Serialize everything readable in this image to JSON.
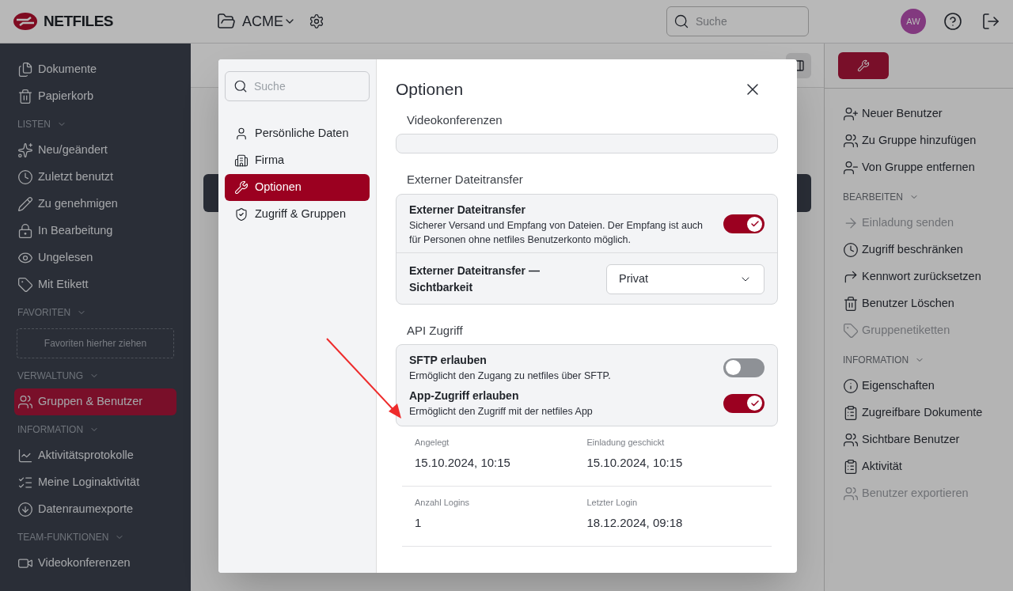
{
  "header": {
    "logo": "NETFILES",
    "workspace": "ACME",
    "search": {
      "placeholder": "Suche"
    },
    "avatar": "AW"
  },
  "sidebar": {
    "sections": [
      {
        "items": [
          {
            "label": "Dokumente",
            "selected": false
          },
          {
            "label": "Papierkorb",
            "selected": false
          }
        ]
      },
      {
        "title": "LISTEN",
        "items": [
          {
            "label": "Neu/geändert",
            "selected": false
          },
          {
            "label": "Zuletzt benutzt",
            "selected": false
          },
          {
            "label": "Zu genehmigen",
            "selected": false
          },
          {
            "label": "In Bearbeitung",
            "selected": false
          },
          {
            "label": "Ungelesen",
            "selected": false
          },
          {
            "label": "Mit Etikett",
            "selected": false
          }
        ]
      },
      {
        "title": "FAVORITEN",
        "dropzone": "Favoriten hierher ziehen"
      },
      {
        "title": "VERWALTUNG",
        "items": [
          {
            "label": "Gruppen & Benutzer",
            "selected": true
          }
        ]
      },
      {
        "title": "INFORMATION",
        "items": [
          {
            "label": "Aktivitätsprotokolle",
            "selected": false
          },
          {
            "label": "Meine Loginaktivität",
            "selected": false
          },
          {
            "label": "Datenraumexporte",
            "selected": false
          }
        ]
      },
      {
        "title": "TEAM-FUNKTIONEN",
        "items": [
          {
            "label": "Videokonferenzen",
            "selected": false
          }
        ]
      }
    ]
  },
  "right_panel": {
    "sections": [
      {
        "items": [
          {
            "label": "Neuer Benutzer",
            "disabled": false
          },
          {
            "label": "Zu Gruppe hinzufügen",
            "disabled": false
          },
          {
            "label": "Von Gruppe entfernen",
            "disabled": false
          }
        ]
      },
      {
        "title": "BEARBEITEN",
        "items": [
          {
            "label": "Einladung senden",
            "disabled": true
          },
          {
            "label": "Zugriff beschränken",
            "disabled": false
          },
          {
            "label": "Kennwort zurücksetzen",
            "disabled": false
          },
          {
            "label": "Benutzer Löschen",
            "disabled": false
          },
          {
            "label": "Gruppenetiketten",
            "disabled": true
          }
        ]
      },
      {
        "title": "INFORMATION",
        "items": [
          {
            "label": "Eigenschaften",
            "disabled": false
          },
          {
            "label": "Zugreifbare Dokumente",
            "disabled": false
          },
          {
            "label": "Sichtbare Benutzer",
            "disabled": false
          },
          {
            "label": "Aktivität",
            "disabled": false
          },
          {
            "label": "Benutzer exportieren",
            "disabled": true
          }
        ]
      }
    ]
  },
  "modal": {
    "title": "Optionen",
    "search": {
      "placeholder": "Suche"
    },
    "nav": [
      {
        "label": "Persönliche Daten",
        "selected": false
      },
      {
        "label": "Firma",
        "selected": false
      },
      {
        "label": "Optionen",
        "selected": true
      },
      {
        "label": "Zugriff & Gruppen",
        "selected": false
      }
    ],
    "sections": [
      {
        "title": "Videokonferenzen"
      },
      {
        "title": "Externer Dateitransfer",
        "rows": [
          {
            "kind": "toggle",
            "title": "Externer Dateitransfer",
            "description": "Sicherer Versand und Empfang von Dateien. Der Empfang ist auch für Personen ohne netfiles Benutzerkonto möglich.",
            "on": true
          },
          {
            "kind": "select",
            "title": "Externer Dateitransfer — Sichtbarkeit",
            "value": "Privat"
          }
        ]
      },
      {
        "title": "API Zugriff",
        "rows": [
          {
            "kind": "toggle",
            "title": "SFTP erlauben",
            "description": "Ermöglicht den Zugang zu netfiles über SFTP.",
            "on": false
          },
          {
            "kind": "toggle",
            "title": "App-Zugriff erlauben",
            "description": "Ermöglicht den Zugriff mit der netfiles App",
            "on": true
          }
        ]
      }
    ],
    "info": [
      [
        {
          "label": "Angelegt",
          "value": "15.10.2024, 10:15"
        },
        {
          "label": "Einladung geschickt",
          "value": "15.10.2024, 10:15"
        }
      ],
      [
        {
          "label": "Anzahl Logins",
          "value": "1"
        },
        {
          "label": "Letzter Login",
          "value": "18.12.2024, 09:18"
        }
      ]
    ]
  }
}
